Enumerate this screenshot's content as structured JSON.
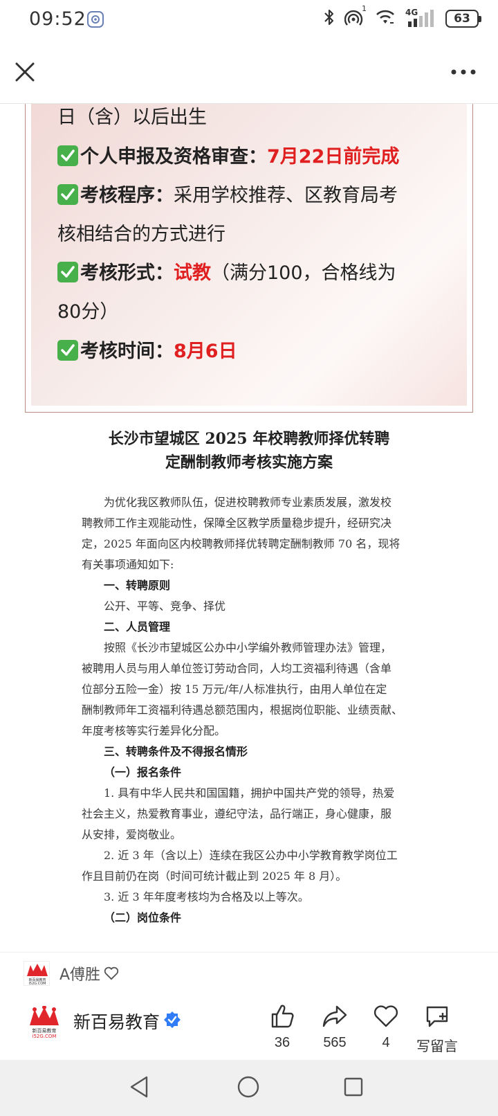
{
  "status_bar": {
    "time": "09:52",
    "network": "4G",
    "signal_superscript": "1",
    "battery": "63"
  },
  "card": {
    "line1": "日（含）以后出生",
    "item1_label": "个人申报及资格审查：",
    "item1_value": "7月22日前完成",
    "item2_label": "考核程序：",
    "item2_text": "采用学校推荐、区教育局考",
    "item2_cont": "核相结合的方式进行",
    "item3_label": "考核形式：",
    "item3_value": "试教",
    "item3_text": "（满分100，合格线为",
    "item3_cont": "80分）",
    "item4_label": "考核时间：",
    "item4_value": "8月6日"
  },
  "doc": {
    "title_line1": "长沙市望城区 2025 年校聘教师择优转聘",
    "title_line2": "定酬制教师考核实施方案",
    "lines": [
      "为优化我区教师队伍，促进校聘教师专业素质发展，激发校",
      "聘教师工作主观能动性，保障全区教学质量稳步提升，经研究决",
      "定，2025 年面向区内校聘教师择优转聘定酬制教师 70 名，现将",
      "有关事项通知如下:",
      "一、转聘原则",
      "公开、平等、竞争、择优",
      "二、人员管理",
      "按照《长沙市望城区公办中小学编外教师管理办法》管理，",
      "被聘用人员与用人单位签订劳动合同，人均工资福利待遇（含单",
      "位部分五险一金）按 15 万元/年/人标准执行，由用人单位在定",
      "酬制教师年工资福利待遇总额范围内，根据岗位职能、业绩贡献、",
      "年度考核等实行差异化分配。",
      "三、转聘条件及不得报名情形",
      "（一）报名条件",
      "1. 具有中华人民共和国国籍，拥护中国共产党的领导，热爱",
      "社会主义，热爱教育事业，遵纪守法，品行端正，身心健康，服",
      "从安排，爱岗敬业。",
      "2. 近 3 年（含以上）连续在我区公办中小学教育教学岗位工",
      "作且目前仍在岗（时间可统计截止到 2025 年 8 月）。",
      "3. 近 3 年年度考核均为合格及以上等次。",
      "（二）岗位条件"
    ]
  },
  "author": {
    "name": "A傅胜",
    "logo_text": "新百易教育",
    "logo_sub": "i52G.COM"
  },
  "account": {
    "name": "新百易教育",
    "logo_text": "新百易教育",
    "logo_sub": "i52G.COM"
  },
  "actions": {
    "like_count": "36",
    "share_count": "565",
    "favorite_count": "4",
    "comment_label": "写留言"
  },
  "colors": {
    "highlight_red": "#e02020",
    "check_green": "#47b04b",
    "verified_blue": "#2f7cf6",
    "brand_red": "#e0262b"
  }
}
